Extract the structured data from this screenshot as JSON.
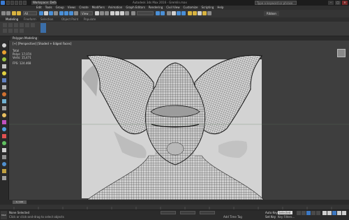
{
  "window": {
    "workspace": "Workspace: Default",
    "title": "Autodesk 3ds Max 2016 - Gremlin.max",
    "search_placeholder": "Type a keyword or phrase"
  },
  "menus": [
    "Edit",
    "Tools",
    "Group",
    "Views",
    "Create",
    "Modifiers",
    "Animation",
    "Graph Editors",
    "Rendering",
    "Civil View",
    "Customize",
    "Scripting",
    "Help"
  ],
  "toolbar": {
    "selection_filter": "All",
    "ref_coord": "View",
    "ribbon_toggle": "Ribbon"
  },
  "ribbon": {
    "tabs": [
      "Modeling",
      "Freeform",
      "Selection",
      "Object Paint",
      "Populate"
    ],
    "active_tab": "Modeling",
    "panel_caption": "Polygon Modeling"
  },
  "viewport": {
    "label": "[+] [Perspective] [Shaded + Edged Faces]",
    "stats": {
      "header": "Total",
      "polys_label": "Polys:",
      "polys": "17,074",
      "verts_label": "Verts:",
      "verts": "15,471",
      "fps_label": "FPS:",
      "fps": "124.468"
    }
  },
  "timeline": {
    "frame": "0 / 100"
  },
  "status": {
    "object_count": "None Selected",
    "prompt": "Click or click-and-drag to select objects",
    "script_label": "MAX",
    "add_time_tag": "Add Time Tag",
    "auto_key": "Auto Key",
    "set_key": "Set Key",
    "key_filter": "Selected",
    "key_filters_btn": "Key Filters..."
  },
  "colors": {
    "accent": "#4a8fd6",
    "mesh_wire": "#1e1e1e",
    "viewport_bg": "#3e3e3e"
  }
}
